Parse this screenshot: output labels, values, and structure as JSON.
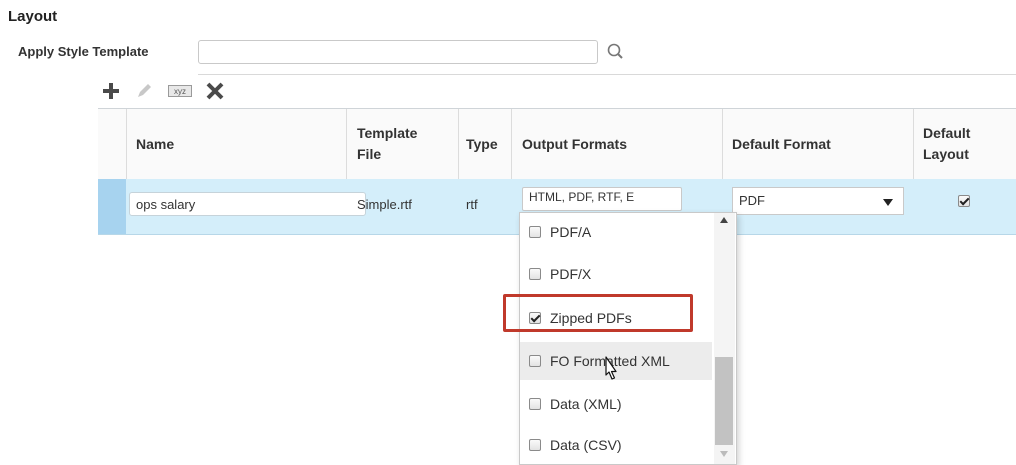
{
  "section": {
    "title": "Layout"
  },
  "style_template": {
    "label": "Apply Style Template",
    "value": "",
    "search_icon": "magnifier-icon"
  },
  "toolbar": {
    "add": "plus-icon",
    "edit": "pencil-icon",
    "localize": "xyz",
    "delete": "x-icon"
  },
  "grid": {
    "headers": {
      "name": "Name",
      "template_file_1": "Template",
      "template_file_2": "File",
      "type": "Type",
      "output_formats": "Output Formats",
      "default_format": "Default Format",
      "default_layout_1": "Default",
      "default_layout_2": "Layout"
    },
    "row": {
      "name": "ops salary",
      "template_file": "Simple.rtf",
      "type": "rtf",
      "output_formats": "HTML, PDF, RTF, E",
      "default_format": "PDF",
      "default_layout_checked": true
    }
  },
  "dropdown": {
    "items": [
      {
        "label": "PDF/A",
        "checked": false
      },
      {
        "label": "PDF/X",
        "checked": false
      },
      {
        "label": "Zipped PDFs",
        "checked": true
      },
      {
        "label": "FO Formatted XML",
        "checked": false
      },
      {
        "label": "Data (XML)",
        "checked": false
      },
      {
        "label": "Data (CSV)",
        "checked": false
      }
    ]
  },
  "colors": {
    "highlight": "#c0392b",
    "row_selected": "#d4eefa",
    "row_handle": "#a7d3ef"
  }
}
